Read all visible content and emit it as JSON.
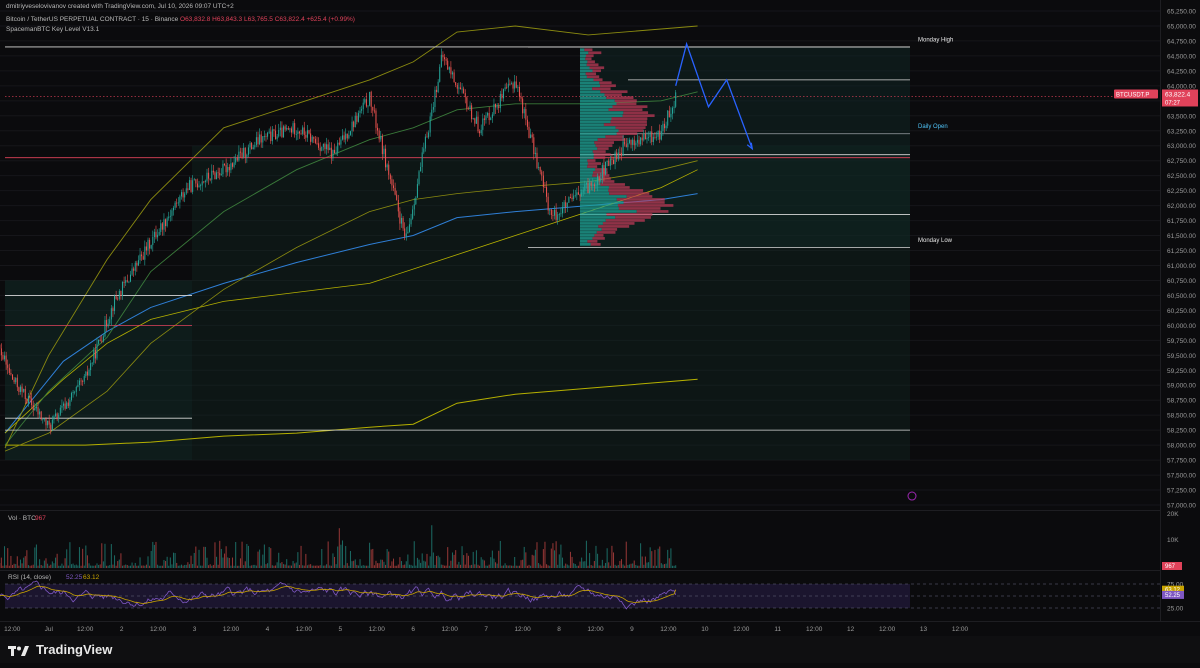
{
  "header": {
    "attribution": "dmitriyveselovivanov created with TradingView.com, Jul 10, 2026 09:07 UTC+2",
    "symbol_line": "Bitcoin / TetherUS PERPETUAL CONTRACT · 15 · Binance",
    "ohlc": "O63,832.8 H63,843.3 L63,765.5 C63,822.4",
    "change": "+625.4 (+0.99%)",
    "indicator": "SpacemanBTC Key Level V13.1"
  },
  "volume_pane": {
    "label": "Vol · BTC",
    "value": "967",
    "scale_top": "20K",
    "scale_mid": "10K",
    "last_badge": "967"
  },
  "rsi_pane": {
    "label": "RSI (14, close)",
    "rsi_value": "52.25",
    "ma_value": "63.12",
    "levels": [
      "75.00",
      "50.00",
      "25.00"
    ]
  },
  "price_tag": {
    "symbol": "BTCUSDT.P",
    "price": "63,822.4",
    "countdown": "07:27"
  },
  "annotations": {
    "monday_high": "Monday High",
    "monday_low": "Monday Low",
    "daily_open": "Daily Open"
  },
  "footer": {
    "brand": "TradingView"
  },
  "colors": {
    "bg": "#0b0b0d",
    "up": "#26a69a",
    "down": "#ef5350",
    "projection": "#2962ff",
    "ema_yellow": "#b5b000",
    "ema_blue": "#2f7fd6"
  },
  "chart_data": {
    "type": "line",
    "title": "Bitcoin / TetherUS PERPETUAL CONTRACT · 15 · Binance",
    "interval": "15",
    "x_ticks": [
      "12:00",
      "Jul",
      "12:00",
      "2",
      "12:00",
      "3",
      "12:00",
      "4",
      "12:00",
      "5",
      "12:00",
      "6",
      "12:00",
      "7",
      "12:00",
      "8",
      "12:00",
      "9",
      "12:00",
      "10",
      "12:00",
      "11",
      "12:00",
      "12",
      "12:00",
      "13",
      "12:00"
    ],
    "y_ticks": [
      57000,
      57250,
      57500,
      57750,
      58000,
      58250,
      58500,
      58750,
      59000,
      59250,
      59500,
      59750,
      60000,
      60250,
      60500,
      60750,
      61000,
      61250,
      61500,
      61750,
      62000,
      62250,
      62500,
      62750,
      63000,
      63250,
      63500,
      63750,
      64000,
      64250,
      64500,
      64750,
      65000,
      65250
    ],
    "ylim": [
      56950,
      65300
    ],
    "series": [
      {
        "name": "BTCUSDT.P",
        "x": [
          0.0,
          0.5,
          1.0,
          1.5,
          1.9,
          2.4,
          2.9,
          3.4,
          3.9,
          4.4,
          4.9,
          5.4,
          5.9,
          6.4,
          6.9,
          7.4,
          7.9,
          8.4,
          8.9,
          9.4,
          9.6
        ],
        "y": [
          60500,
          59100,
          58300,
          59100,
          60400,
          61400,
          62300,
          62600,
          63100,
          63300,
          62850,
          63800,
          61400,
          64500,
          63300,
          64100,
          61800,
          62300,
          63000,
          63200,
          63822.4
        ]
      }
    ],
    "key_levels": [
      {
        "label": "Monday High",
        "value": 64650
      },
      {
        "label": "Monday Low",
        "value": 61300
      },
      {
        "label": "Daily Open",
        "value": 63200
      }
    ],
    "projection": {
      "x": [
        9.6,
        9.75,
        10.05,
        10.3,
        10.65
      ],
      "y": [
        64000,
        64700,
        63650,
        64100,
        62950
      ]
    },
    "volume": {
      "ylim": [
        0,
        20000
      ],
      "last": 967
    },
    "rsi": {
      "ylim": [
        0,
        100
      ],
      "levels": [
        75,
        50,
        25
      ],
      "rsi": 52.25,
      "rsi_ma": 63.12
    }
  }
}
